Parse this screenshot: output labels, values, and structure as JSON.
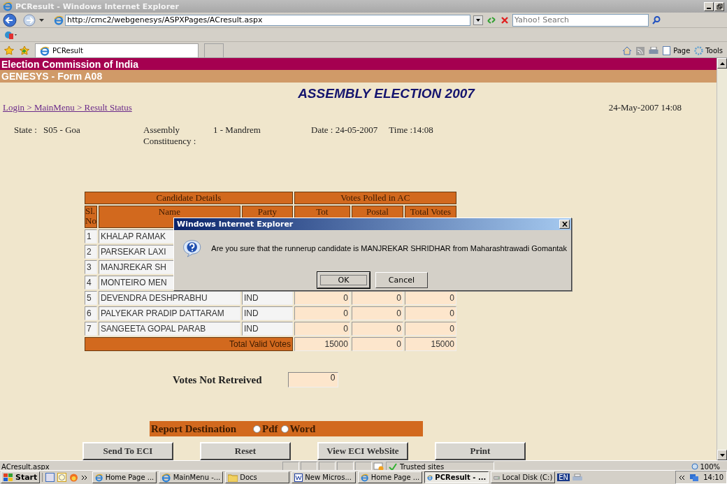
{
  "window": {
    "title": "PCResult - Windows Internet Explorer"
  },
  "address_bar": {
    "value": "http://cmc2/webgenesys/ASPXPages/ACresult.aspx"
  },
  "search": {
    "placeholder": "Yahoo! Search"
  },
  "tabs": [
    {
      "label": "PCResult",
      "selected": true
    }
  ],
  "command_bar": {
    "items": [
      "Page",
      "Tools"
    ]
  },
  "page": {
    "header": "Election Commission of India",
    "subheader": "GENESYS - Form A08",
    "title": "ASSEMBLY ELECTION 2007",
    "breadcrumb": "Login > MainMenu > Result Status",
    "datetime": "24-May-2007 14:08",
    "state_label": "State :",
    "state": "S05 - Goa",
    "assembly_label": "Assembly Constituency :",
    "assembly": "1 - Mandrem",
    "date": "Date : 24-05-2007",
    "time": "Time :14:08",
    "table": {
      "group_headers": [
        "Candidate Details",
        "Votes Polled in AC"
      ],
      "columns": [
        "Sl. No",
        "Name",
        "Party",
        "Tot",
        "Postal",
        "Total Votes"
      ],
      "rows": [
        {
          "sl": "1",
          "name": "KHALAP RAMAK"
        },
        {
          "sl": "2",
          "name": "PARSEKAR LAXI"
        },
        {
          "sl": "3",
          "name": "MANJREKAR SH"
        },
        {
          "sl": "4",
          "name": "MONTEIRO MEN"
        },
        {
          "sl": "5",
          "name": "DEVENDRA DESHPRABHU",
          "party": "IND",
          "tot": "0",
          "postal": "0",
          "total": "0"
        },
        {
          "sl": "6",
          "name": "PALYEKAR PRADIP DATTARAM",
          "party": "IND",
          "tot": "0",
          "postal": "0",
          "total": "0"
        },
        {
          "sl": "7",
          "name": "SANGEETA GOPAL PARAB",
          "party": "IND",
          "tot": "0",
          "postal": "0",
          "total": "0"
        }
      ],
      "total_row": {
        "label": "Total Valid Votes",
        "tot": "15000",
        "postal": "0",
        "total": "15000"
      }
    },
    "votes_not_retrieved": {
      "label": "Votes Not Retreived",
      "value": "0"
    },
    "report_destination": {
      "label": "Report Destination",
      "options": [
        {
          "label": "Pdf",
          "selected": false
        },
        {
          "label": "Word",
          "selected": false
        }
      ]
    },
    "buttons": [
      "Send To ECI",
      "Reset",
      "View ECI WebSite",
      "Print"
    ]
  },
  "dialog": {
    "title": "Windows Internet Explorer",
    "message": "Are you sure that the runnerup candidate is MANJREKAR SHRIDHAR from Maharashtrawadi Gomantak",
    "buttons": [
      {
        "label": "OK",
        "focused": true
      },
      {
        "label": "Cancel",
        "focused": false
      }
    ]
  },
  "status_bar": {
    "text": "ACresult.aspx",
    "zone": "Trusted sites",
    "zoom": "100%"
  },
  "taskbar": {
    "start": "Start",
    "items": [
      {
        "label": "Home Page ...",
        "kind": "ie",
        "selected": false
      },
      {
        "label": "MainMenu -...",
        "kind": "ie",
        "selected": false
      },
      {
        "label": "Docs",
        "kind": "folder",
        "selected": false
      },
      {
        "label": "New Micros...",
        "kind": "word",
        "selected": false
      },
      {
        "label": "Home Page ...",
        "kind": "ie",
        "selected": false
      },
      {
        "label": "PCResult - ...",
        "kind": "ie",
        "selected": true
      },
      {
        "label": "Local Disk (C:)",
        "kind": "disk",
        "selected": false
      }
    ],
    "language": "EN",
    "clock": "14:10"
  }
}
